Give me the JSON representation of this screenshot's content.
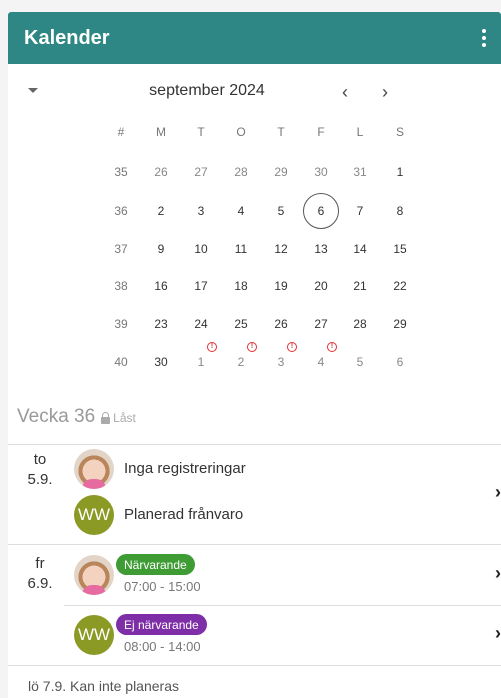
{
  "header": {
    "title": "Kalender"
  },
  "calendar": {
    "month_label": "september 2024",
    "prev_symbol": "‹",
    "next_symbol": "›",
    "weekday_headers": [
      "#",
      "M",
      "T",
      "O",
      "T",
      "F",
      "L",
      "S"
    ],
    "weeks": [
      {
        "week": "35",
        "days": [
          "26",
          "27",
          "28",
          "29",
          "30",
          "31",
          "1"
        ]
      },
      {
        "week": "36",
        "days": [
          "2",
          "3",
          "4",
          "5",
          "6",
          "7",
          "8"
        ]
      },
      {
        "week": "37",
        "days": [
          "9",
          "10",
          "11",
          "12",
          "13",
          "14",
          "15"
        ]
      },
      {
        "week": "38",
        "days": [
          "16",
          "17",
          "18",
          "19",
          "20",
          "21",
          "22"
        ]
      },
      {
        "week": "39",
        "days": [
          "23",
          "24",
          "25",
          "26",
          "27",
          "28",
          "29"
        ]
      },
      {
        "week": "40",
        "days": [
          "30",
          "1",
          "2",
          "3",
          "4",
          "5",
          "6"
        ]
      }
    ],
    "today": "6",
    "alert_symbol": "!"
  },
  "week_section": {
    "title": "Vecka 36",
    "lock_label": "Låst"
  },
  "days": [
    {
      "day_name": "to",
      "date": "5.9.",
      "entries": [
        {
          "avatar": "photo",
          "text": "Inga registreringar"
        },
        {
          "avatar": "WW",
          "text": "Planerad frånvaro"
        }
      ]
    },
    {
      "day_name": "fr",
      "date": "6.9.",
      "entries": [
        {
          "avatar": "photo",
          "badge": "Närvarande",
          "badge_color": "#3f9c35",
          "time": "07:00 - 15:00"
        },
        {
          "avatar": "WW",
          "badge": "Ej närvarande",
          "badge_color": "#7e2ea6",
          "time": "08:00 - 14:00"
        }
      ]
    }
  ],
  "footer_text": "lö 7.9. Kan inte planeras",
  "chevron_symbol": "›"
}
